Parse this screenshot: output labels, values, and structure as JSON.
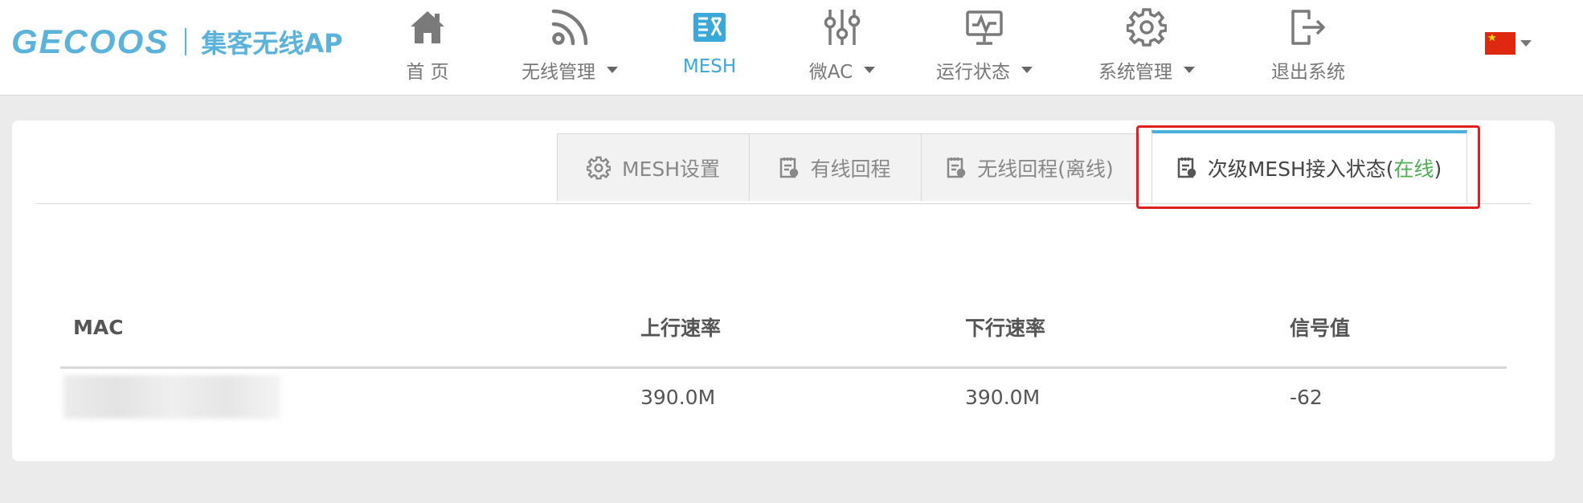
{
  "header": {
    "logo_brand": "GECOOS",
    "logo_sub": "集客无线AP",
    "nav": [
      {
        "label": "首 页",
        "icon": "home-icon",
        "dropdown": false
      },
      {
        "label": "无线管理",
        "icon": "wifi-icon",
        "dropdown": true
      },
      {
        "label": "MESH",
        "icon": "mesh-icon",
        "dropdown": false,
        "active": true
      },
      {
        "label": "微AC",
        "icon": "sliders-icon",
        "dropdown": true
      },
      {
        "label": "运行状态",
        "icon": "monitor-icon",
        "dropdown": true
      },
      {
        "label": "系统管理",
        "icon": "gear-icon",
        "dropdown": true
      },
      {
        "label": "退出系统",
        "icon": "logout-icon",
        "dropdown": false
      }
    ],
    "language": {
      "flag": "cn-flag-icon"
    }
  },
  "tabs": {
    "mesh_settings": "MESH设置",
    "wired_backhaul": "有线回程",
    "wireless_backhaul": "无线回程(离线)",
    "sub_mesh_prefix": "次级MESH接入状态(",
    "sub_mesh_status": "在线",
    "sub_mesh_suffix": ")"
  },
  "table": {
    "headers": {
      "mac": "MAC",
      "up": "上行速率",
      "down": "下行速率",
      "signal": "信号值"
    },
    "rows": [
      {
        "mac": "",
        "up": "390.0M",
        "down": "390.0M",
        "signal": "-62"
      }
    ]
  },
  "colors": {
    "accent": "#3aa8d8",
    "online": "#4caf50",
    "highlight": "#e02020"
  }
}
